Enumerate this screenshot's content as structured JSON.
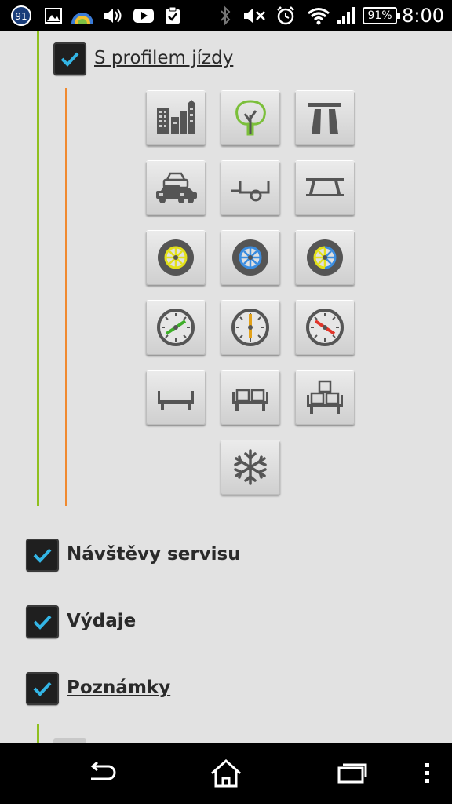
{
  "status_bar": {
    "notification_badge": "91",
    "battery": "91%",
    "time": "8:00",
    "icons": [
      "notification-badge-icon",
      "image-icon",
      "weather-icon",
      "volume-icon",
      "youtube-icon",
      "clipboard-check-icon",
      "bluetooth-icon",
      "mute-icon",
      "alarm-icon",
      "wifi-icon",
      "signal-icon",
      "battery-icon"
    ]
  },
  "sections": {
    "drive_profile": {
      "label": "S profilem jízdy",
      "checked": true
    },
    "service_visits": {
      "label": "Návštěvy servisu",
      "checked": true
    },
    "expenses": {
      "label": "Výdaje",
      "checked": true
    },
    "notes": {
      "label": "Poznámky",
      "checked": true
    }
  },
  "profile_tiles": [
    "city-icon",
    "countryside-tree-icon",
    "highway-icon",
    "traffic-cars-icon",
    "trailer-icon",
    "roof-rack-icon",
    "summer-tire-icon",
    "winter-tire-icon",
    "allseason-tire-icon",
    "speed-low-gauge-icon",
    "speed-medium-gauge-icon",
    "speed-high-gauge-icon",
    "load-empty-icon",
    "load-medium-icon",
    "load-full-icon",
    "air-conditioning-snowflake-icon"
  ],
  "colors": {
    "green_line": "#8fbf1f",
    "orange_line": "#f08a30",
    "check_mark": "#33b5e5"
  },
  "nav_bar": {
    "icons": [
      "back-icon",
      "home-icon",
      "recent-apps-icon",
      "overflow-menu-icon"
    ]
  }
}
